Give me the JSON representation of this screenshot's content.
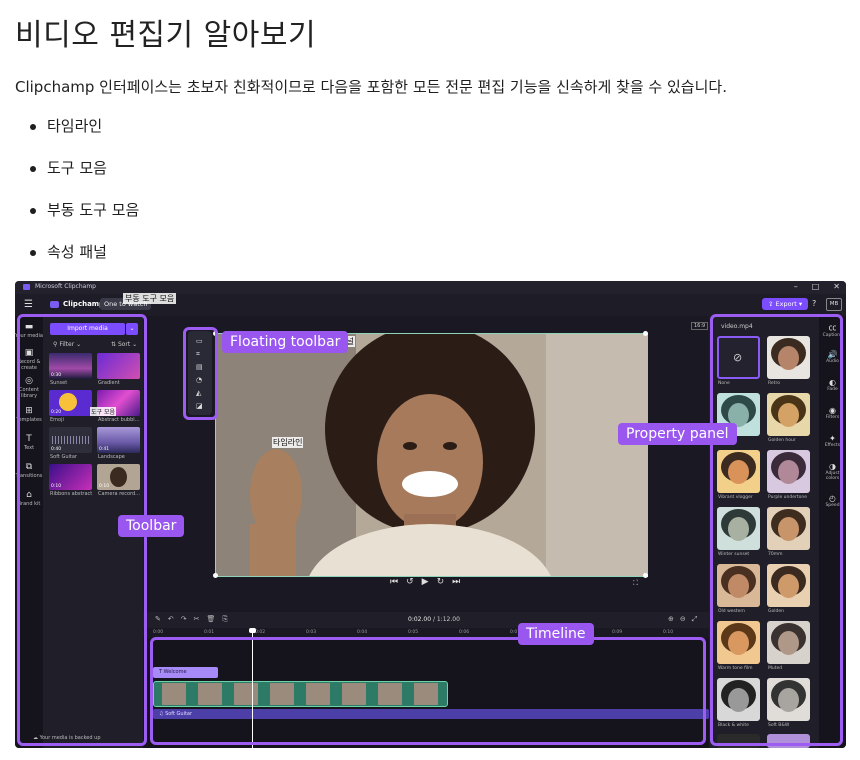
{
  "heading": "비디오 편집기 알아보기",
  "intro": "Clipchamp 인터페이스는 초보자 친화적이므로 다음을 포함한 모든 전문 편집 기능을 신속하게 찾을 수 있습니다.",
  "bullets": [
    "타임라인",
    "도구 모음",
    "부동 도구 모음",
    "속성 패널"
  ],
  "screenshot": {
    "window_title": "Microsoft Clipchamp",
    "app_name": "Clipchamp",
    "one_to_watch": "One to watch",
    "overlay_floating_ko": "부동 도구 모음",
    "overlay_property_ko": "속성 패널",
    "overlay_timeline_ko": "타임라인",
    "overlay_toolbar_ko": "도구 모음",
    "export_label": "Export",
    "avatar_initials": "MB",
    "aspect_ratio": "16:9",
    "left_rail": [
      {
        "icon": "media-icon",
        "label": "Your media"
      },
      {
        "icon": "record-icon",
        "label": "Record & create"
      },
      {
        "icon": "library-icon",
        "label": "Content library"
      },
      {
        "icon": "templates-icon",
        "label": "Templates"
      },
      {
        "icon": "text-icon",
        "label": "Text"
      },
      {
        "icon": "transitions-icon",
        "label": "Transitions"
      },
      {
        "icon": "brand-icon",
        "label": "Brand kit"
      }
    ],
    "import_media": "Import media",
    "filter_label": "Filter",
    "sort_label": "Sort",
    "media": [
      {
        "name": "Sunset",
        "duration": "0:30"
      },
      {
        "name": "Gradient",
        "duration": ""
      },
      {
        "name": "Emoji",
        "duration": "0:20"
      },
      {
        "name": "Abstract bubbl...",
        "duration": "0:15"
      },
      {
        "name": "Soft Guitar",
        "duration": "0:40"
      },
      {
        "name": "Landscape",
        "duration": "0:41"
      },
      {
        "name": "Ribbons abstract",
        "duration": "0:10"
      },
      {
        "name": "Camera record...",
        "duration": "0:10"
      }
    ],
    "backed_up": "Your media is backed up",
    "callouts": {
      "floating_toolbar": "Floating toolbar",
      "property_panel": "Property panel",
      "toolbar": "Toolbar",
      "timeline": "Timeline"
    },
    "time_current": "0:02.00",
    "time_total": "/ 1:12.00",
    "ruler_ticks": [
      "0:00",
      "0:01",
      "0:02",
      "0:03",
      "0:04",
      "0:05",
      "0:06",
      "0:07",
      "0:08",
      "0:09",
      "0:10"
    ],
    "text_clip": "Welcome",
    "audio_clip": "Soft Guitar",
    "right_panel_title": "video.mp4",
    "filters": [
      "None",
      "Retro",
      "",
      "Golden hour",
      "Vibrant vlogger",
      "Purple undertone",
      "Winter sunset",
      "70mm",
      "Old western",
      "Golden",
      "Warm tone film",
      "Muted",
      "Black & white",
      "Soft B&W"
    ],
    "right_rail": [
      {
        "icon": "captions-icon",
        "label": "Captions"
      },
      {
        "icon": "audio-icon",
        "label": "Audio"
      },
      {
        "icon": "fade-icon",
        "label": "Fade"
      },
      {
        "icon": "filters-icon",
        "label": "Filters"
      },
      {
        "icon": "effects-icon",
        "label": "Effects"
      },
      {
        "icon": "adjust-colors-icon",
        "label": "Adjust colors"
      },
      {
        "icon": "speed-icon",
        "label": "Speed"
      }
    ]
  }
}
